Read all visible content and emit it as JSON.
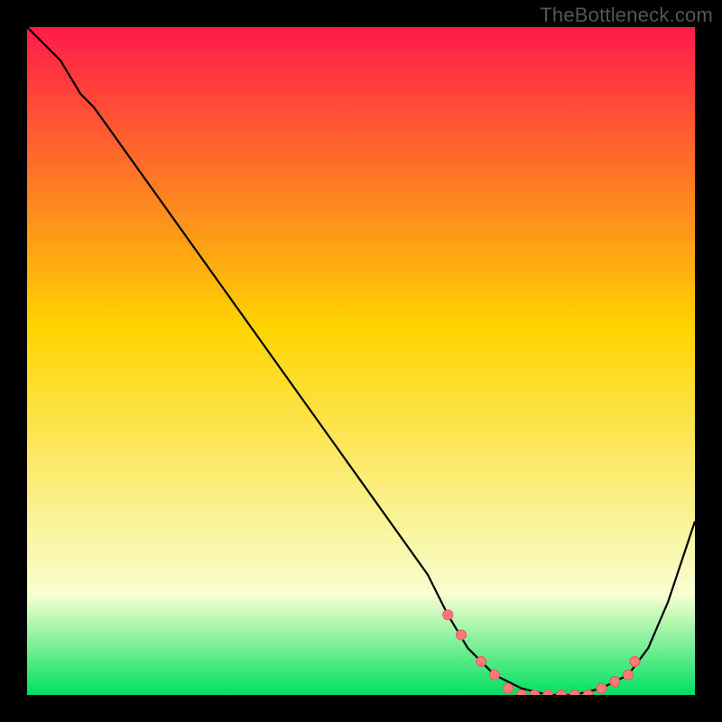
{
  "watermark": "TheBottleneck.com",
  "colors": {
    "gradient_top": "#ff1a4a",
    "gradient_mid": "#ffd400",
    "gradient_low": "#f8ffd0",
    "gradient_bottom": "#00e060",
    "curve": "#000000",
    "marker_fill": "#ff7a7a",
    "marker_stroke": "#e55a5a"
  },
  "chart_data": {
    "type": "line",
    "title": "",
    "xlabel": "",
    "ylabel": "",
    "xlim": [
      0,
      100
    ],
    "ylim": [
      0,
      100
    ],
    "grid": false,
    "legend": false,
    "series": [
      {
        "name": "curve",
        "x": [
          0,
          5,
          8,
          10,
          20,
          30,
          40,
          50,
          60,
          63,
          66,
          70,
          74,
          78,
          82,
          86,
          90,
          93,
          96,
          100
        ],
        "values": [
          100,
          95,
          90,
          88,
          74,
          60,
          46,
          32,
          18,
          12,
          7,
          3,
          1,
          0,
          0,
          1,
          3,
          7,
          14,
          26
        ]
      }
    ],
    "markers": {
      "name": "highlight-dots",
      "x": [
        63,
        65,
        68,
        70,
        72,
        74,
        76,
        78,
        80,
        82,
        84,
        86,
        88,
        90,
        91
      ],
      "values": [
        12,
        9,
        5,
        3,
        1,
        0,
        0,
        0,
        0,
        0,
        0,
        1,
        2,
        3,
        5
      ]
    }
  }
}
